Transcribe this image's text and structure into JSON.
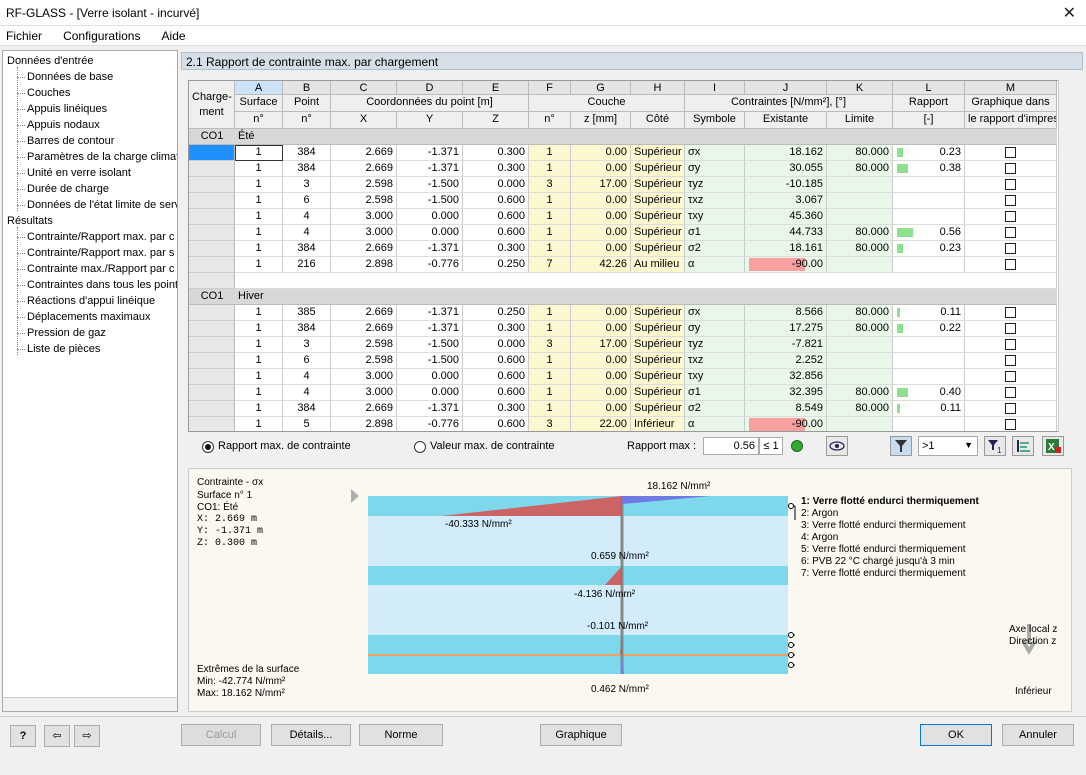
{
  "window": {
    "title": "RF-GLASS - [Verre isolant - incurvé]",
    "close_glyph": "✕"
  },
  "menu": [
    "Fichier",
    "Configurations",
    "Aide"
  ],
  "nav": {
    "group_input": "Données d'entrée",
    "input_items": [
      "Données de base",
      "Couches",
      "Appuis linéiques",
      "Appuis nodaux",
      "Barres de contour",
      "Paramètres de la charge climati",
      "Unité en verre isolant",
      "Durée de charge",
      "Données de l'état limite de serv"
    ],
    "group_results": "Résultats",
    "result_items": [
      "Contrainte/Rapport max. par c",
      "Contrainte/Rapport max. par s",
      "Contrainte max./Rapport par c",
      "Contraintes dans tous les point",
      "Réactions d'appui linéique",
      "Déplacements maximaux",
      "Pression de gaz",
      "Liste de pièces"
    ]
  },
  "panel": {
    "title": "2.1 Rapport de contrainte max. par chargement"
  },
  "table": {
    "letters": [
      "A",
      "B",
      "C",
      "D",
      "E",
      "F",
      "G",
      "H",
      "I",
      "J",
      "K",
      "L",
      "M"
    ],
    "h_charge": "Charge-\nment",
    "h1": {
      "A": "Surface",
      "B": "Point",
      "CDE": "Coordonnées du point [m]",
      "FGH": "Couche",
      "IJK": "Contraintes [N/mm²], [°]",
      "L": "Rapport",
      "M": "Graphique dans"
    },
    "h2": {
      "A": "n°",
      "B": "n°",
      "C": "X",
      "D": "Y",
      "E": "Z",
      "F": "n°",
      "G": "z [mm]",
      "H": "Côté",
      "I": "Symbole",
      "J": "Existante",
      "K": "Limite",
      "L": "[-]",
      "M": "le rapport d'impres"
    },
    "groups": [
      {
        "co": "CO1",
        "name": "Été",
        "rows": [
          {
            "surf": "1",
            "pt": "384",
            "x": "2.669",
            "y": "-1.371",
            "z": "0.300",
            "lay": "1",
            "zmm": "0.00",
            "side": "Supérieur",
            "sym": "σx",
            "exi": "18.162",
            "lim": "80.000",
            "rat": "0.23",
            "ratio_value": 0.23,
            "neg": false
          },
          {
            "surf": "1",
            "pt": "384",
            "x": "2.669",
            "y": "-1.371",
            "z": "0.300",
            "lay": "1",
            "zmm": "0.00",
            "side": "Supérieur",
            "sym": "σy",
            "exi": "30.055",
            "lim": "80.000",
            "rat": "0.38",
            "ratio_value": 0.38,
            "neg": false
          },
          {
            "surf": "1",
            "pt": "3",
            "x": "2.598",
            "y": "-1.500",
            "z": "0.000",
            "lay": "3",
            "zmm": "17.00",
            "side": "Supérieur",
            "sym": "τyz",
            "exi": "-10.185",
            "lim": "",
            "rat": "",
            "ratio_value": 0,
            "neg": false
          },
          {
            "surf": "1",
            "pt": "6",
            "x": "2.598",
            "y": "-1.500",
            "z": "0.600",
            "lay": "1",
            "zmm": "0.00",
            "side": "Supérieur",
            "sym": "τxz",
            "exi": "3.067",
            "lim": "",
            "rat": "",
            "ratio_value": 0,
            "neg": false
          },
          {
            "surf": "1",
            "pt": "4",
            "x": "3.000",
            "y": "0.000",
            "z": "0.600",
            "lay": "1",
            "zmm": "0.00",
            "side": "Supérieur",
            "sym": "τxy",
            "exi": "45.360",
            "lim": "",
            "rat": "",
            "ratio_value": 0,
            "neg": false
          },
          {
            "surf": "1",
            "pt": "4",
            "x": "3.000",
            "y": "0.000",
            "z": "0.600",
            "lay": "1",
            "zmm": "0.00",
            "side": "Supérieur",
            "sym": "σ1",
            "exi": "44.733",
            "lim": "80.000",
            "rat": "0.56",
            "ratio_value": 0.56,
            "neg": false
          },
          {
            "surf": "1",
            "pt": "384",
            "x": "2.669",
            "y": "-1.371",
            "z": "0.300",
            "lay": "1",
            "zmm": "0.00",
            "side": "Supérieur",
            "sym": "σ2",
            "exi": "18.161",
            "lim": "80.000",
            "rat": "0.23",
            "ratio_value": 0.23,
            "neg": false
          },
          {
            "surf": "1",
            "pt": "216",
            "x": "2.898",
            "y": "-0.776",
            "z": "0.250",
            "lay": "7",
            "zmm": "42.26",
            "side": "Au milieu",
            "sym": "α",
            "exi": "-90.00",
            "lim": "",
            "rat": "",
            "ratio_value": 0,
            "neg": true
          }
        ]
      },
      {
        "co": "CO1",
        "name": "Hiver",
        "rows": [
          {
            "surf": "1",
            "pt": "385",
            "x": "2.669",
            "y": "-1.371",
            "z": "0.250",
            "lay": "1",
            "zmm": "0.00",
            "side": "Supérieur",
            "sym": "σx",
            "exi": "8.566",
            "lim": "80.000",
            "rat": "0.11",
            "ratio_value": 0.11,
            "neg": false
          },
          {
            "surf": "1",
            "pt": "384",
            "x": "2.669",
            "y": "-1.371",
            "z": "0.300",
            "lay": "1",
            "zmm": "0.00",
            "side": "Supérieur",
            "sym": "σy",
            "exi": "17.275",
            "lim": "80.000",
            "rat": "0.22",
            "ratio_value": 0.22,
            "neg": false
          },
          {
            "surf": "1",
            "pt": "3",
            "x": "2.598",
            "y": "-1.500",
            "z": "0.000",
            "lay": "3",
            "zmm": "17.00",
            "side": "Supérieur",
            "sym": "τyz",
            "exi": "-7.821",
            "lim": "",
            "rat": "",
            "ratio_value": 0,
            "neg": false
          },
          {
            "surf": "1",
            "pt": "6",
            "x": "2.598",
            "y": "-1.500",
            "z": "0.600",
            "lay": "1",
            "zmm": "0.00",
            "side": "Supérieur",
            "sym": "τxz",
            "exi": "2.252",
            "lim": "",
            "rat": "",
            "ratio_value": 0,
            "neg": false
          },
          {
            "surf": "1",
            "pt": "4",
            "x": "3.000",
            "y": "0.000",
            "z": "0.600",
            "lay": "1",
            "zmm": "0.00",
            "side": "Supérieur",
            "sym": "τxy",
            "exi": "32.856",
            "lim": "",
            "rat": "",
            "ratio_value": 0,
            "neg": false
          },
          {
            "surf": "1",
            "pt": "4",
            "x": "3.000",
            "y": "0.000",
            "z": "0.600",
            "lay": "1",
            "zmm": "0.00",
            "side": "Supérieur",
            "sym": "σ1",
            "exi": "32.395",
            "lim": "80.000",
            "rat": "0.40",
            "ratio_value": 0.4,
            "neg": false
          },
          {
            "surf": "1",
            "pt": "384",
            "x": "2.669",
            "y": "-1.371",
            "z": "0.300",
            "lay": "1",
            "zmm": "0.00",
            "side": "Supérieur",
            "sym": "σ2",
            "exi": "8.549",
            "lim": "80.000",
            "rat": "0.11",
            "ratio_value": 0.11,
            "neg": false
          },
          {
            "surf": "1",
            "pt": "5",
            "x": "2.898",
            "y": "-0.776",
            "z": "0.600",
            "lay": "3",
            "zmm": "22.00",
            "side": "Inférieur",
            "sym": "α",
            "exi": "-90.00",
            "lim": "",
            "rat": "",
            "ratio_value": 0,
            "neg": true
          }
        ]
      }
    ]
  },
  "controls": {
    "radio1": "Rapport max. de contrainte",
    "radio2": "Valeur max. de contrainte",
    "ratio_label": "Rapport max :",
    "ratio_value": "0.56",
    "ratio_limit": "≤ 1",
    "filter": ">1"
  },
  "graphic": {
    "info": [
      "Contrainte - σx",
      "Surface n° 1",
      "CO1: Été",
      "X:  2.669  m",
      "Y: -1.371  m",
      "Z:  0.300  m"
    ],
    "extremes_title": "Extrêmes de la surface",
    "min": "Min:  -42.774 N/mm²",
    "max": "Max:  18.162 N/mm²",
    "labels": {
      "top": "18.162 N/mm²",
      "neg": "-40.333 N/mm²",
      "l3": "0.659 N/mm²",
      "l4": "-4.136 N/mm²",
      "l5": "-0.101 N/mm²",
      "bottom": "0.462 N/mm²"
    },
    "legend": [
      "1: Verre flotté endurci thermiquement",
      "2: Argon",
      "3: Verre flotté endurci thermiquement",
      "4: Argon",
      "5: Verre flotté endurci thermiquement",
      "6: PVB 22 °C chargé jusqu'à 3 min",
      "7: Verre flotté endurci thermiquement"
    ],
    "axis": [
      "Axe local z",
      "Direction z"
    ],
    "axis_bottom": "Inférieur",
    "colors": {
      "glass": "#7ed8ec",
      "gas": "#d2ecfa",
      "neg": "#d9504f",
      "pos": "#6e7be3",
      "pvb": "#f0a060"
    }
  },
  "footer": {
    "calc": "Calcul",
    "details": "Détails...",
    "norme": "Norme",
    "graph": "Graphique",
    "ok": "OK",
    "cancel": "Annuler"
  }
}
